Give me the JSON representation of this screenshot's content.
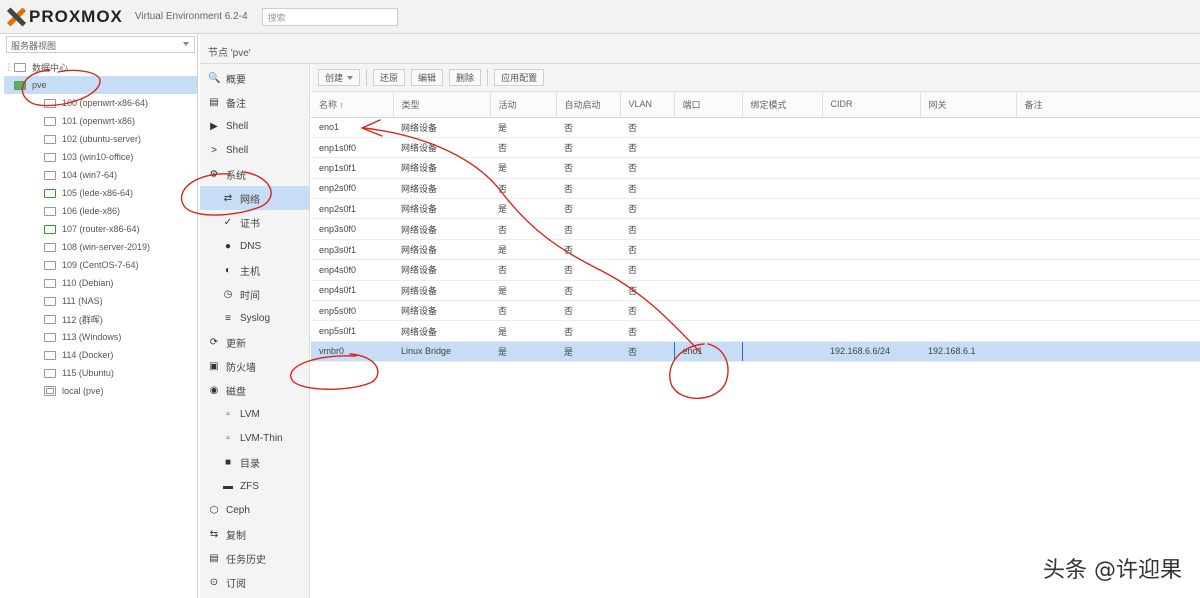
{
  "header": {
    "logo_text": "PROXMOX",
    "version_text": "Virtual Environment 6.2-4",
    "search_placeholder": "搜索"
  },
  "tree": {
    "view_selector": "服务器视图",
    "root": "数据中心",
    "node": "pve",
    "items": [
      {
        "label": "100 (openwrt-x86-64)",
        "state": "stopped"
      },
      {
        "label": "101 (openwrt-x86)",
        "state": "stopped"
      },
      {
        "label": "102 (ubuntu-server)",
        "state": "stopped"
      },
      {
        "label": "103 (win10-office)",
        "state": "stopped"
      },
      {
        "label": "104 (win7-64)",
        "state": "stopped"
      },
      {
        "label": "105 (lede-x86-64)",
        "state": "running"
      },
      {
        "label": "106 (lede-x86)",
        "state": "stopped"
      },
      {
        "label": "107 (router-x86-64)",
        "state": "running"
      },
      {
        "label": "108 (win-server-2019)",
        "state": "stopped"
      },
      {
        "label": "109 (CentOS-7-64)",
        "state": "stopped"
      },
      {
        "label": "110 (Debian)",
        "state": "stopped"
      },
      {
        "label": "111 (NAS)",
        "state": "stopped"
      },
      {
        "label": "112 (群晖)",
        "state": "stopped"
      },
      {
        "label": "113 (Windows)",
        "state": "stopped"
      },
      {
        "label": "114 (Docker)",
        "state": "stopped"
      },
      {
        "label": "115 (Ubuntu)",
        "state": "stopped"
      },
      {
        "label": "local (pve)",
        "state": "storage"
      }
    ]
  },
  "nav": {
    "title": "节点 'pve'",
    "items": [
      {
        "glyph": "🔍",
        "label": "概要",
        "sub": false,
        "active": false
      },
      {
        "glyph": "▤",
        "label": "备注",
        "sub": false,
        "active": false
      },
      {
        "glyph": "▶",
        "label": "Shell",
        "sub": false,
        "active": false
      },
      {
        "glyph": ">",
        "label": "Shell",
        "sub": false,
        "active": false
      },
      {
        "glyph": "⚙",
        "label": "系统",
        "sub": false,
        "active": false
      },
      {
        "glyph": "⇄",
        "label": "网络",
        "sub": true,
        "active": true
      },
      {
        "glyph": "✓",
        "label": "证书",
        "sub": true,
        "active": false
      },
      {
        "glyph": "●",
        "label": "DNS",
        "sub": true,
        "active": false
      },
      {
        "glyph": "◐",
        "label": "主机",
        "sub": true,
        "active": false
      },
      {
        "glyph": "◷",
        "label": "时间",
        "sub": true,
        "active": false
      },
      {
        "glyph": "≡",
        "label": "Syslog",
        "sub": true,
        "active": false
      },
      {
        "glyph": "⟳",
        "label": "更新",
        "sub": false,
        "active": false
      },
      {
        "glyph": "▣",
        "label": "防火墙",
        "sub": false,
        "active": false
      },
      {
        "glyph": "◉",
        "label": "磁盘",
        "sub": false,
        "active": false
      },
      {
        "glyph": "▫",
        "label": "LVM",
        "sub": true,
        "active": false
      },
      {
        "glyph": "▫",
        "label": "LVM-Thin",
        "sub": true,
        "active": false
      },
      {
        "glyph": "■",
        "label": "目录",
        "sub": true,
        "active": false
      },
      {
        "glyph": "▬",
        "label": "ZFS",
        "sub": true,
        "active": false
      },
      {
        "glyph": "⬡",
        "label": "Ceph",
        "sub": false,
        "active": false
      },
      {
        "glyph": "⇆",
        "label": "复制",
        "sub": false,
        "active": false
      },
      {
        "glyph": "▤",
        "label": "任务历史",
        "sub": false,
        "active": false
      },
      {
        "glyph": "⊙",
        "label": "订阅",
        "sub": false,
        "active": false
      }
    ]
  },
  "toolbar": {
    "create": "创建",
    "revert": "还原",
    "edit": "编辑",
    "delete": "删除",
    "apply": "应用配置"
  },
  "grid": {
    "columns": [
      "名称 ↑",
      "类型",
      "活动",
      "自动启动",
      "VLAN",
      "端口",
      "绑定模式",
      "CIDR",
      "网关",
      "备注"
    ],
    "rows": [
      {
        "name": "eno1",
        "type": "网络设备",
        "active": "是",
        "autostart": "否",
        "vlan": "否",
        "ports": "",
        "bond": "",
        "cidr": "",
        "gateway": "",
        "selected": false
      },
      {
        "name": "enp1s0f0",
        "type": "网络设备",
        "active": "否",
        "autostart": "否",
        "vlan": "否",
        "ports": "",
        "bond": "",
        "cidr": "",
        "gateway": "",
        "selected": false
      },
      {
        "name": "enp1s0f1",
        "type": "网络设备",
        "active": "是",
        "autostart": "否",
        "vlan": "否",
        "ports": "",
        "bond": "",
        "cidr": "",
        "gateway": "",
        "selected": false
      },
      {
        "name": "enp2s0f0",
        "type": "网络设备",
        "active": "否",
        "autostart": "否",
        "vlan": "否",
        "ports": "",
        "bond": "",
        "cidr": "",
        "gateway": "",
        "selected": false
      },
      {
        "name": "enp2s0f1",
        "type": "网络设备",
        "active": "是",
        "autostart": "否",
        "vlan": "否",
        "ports": "",
        "bond": "",
        "cidr": "",
        "gateway": "",
        "selected": false
      },
      {
        "name": "enp3s0f0",
        "type": "网络设备",
        "active": "否",
        "autostart": "否",
        "vlan": "否",
        "ports": "",
        "bond": "",
        "cidr": "",
        "gateway": "",
        "selected": false
      },
      {
        "name": "enp3s0f1",
        "type": "网络设备",
        "active": "是",
        "autostart": "否",
        "vlan": "否",
        "ports": "",
        "bond": "",
        "cidr": "",
        "gateway": "",
        "selected": false
      },
      {
        "name": "enp4s0f0",
        "type": "网络设备",
        "active": "否",
        "autostart": "否",
        "vlan": "否",
        "ports": "",
        "bond": "",
        "cidr": "",
        "gateway": "",
        "selected": false
      },
      {
        "name": "enp4s0f1",
        "type": "网络设备",
        "active": "是",
        "autostart": "否",
        "vlan": "否",
        "ports": "",
        "bond": "",
        "cidr": "",
        "gateway": "",
        "selected": false
      },
      {
        "name": "enp5s0f0",
        "type": "网络设备",
        "active": "否",
        "autostart": "否",
        "vlan": "否",
        "ports": "",
        "bond": "",
        "cidr": "",
        "gateway": "",
        "selected": false
      },
      {
        "name": "enp5s0f1",
        "type": "网络设备",
        "active": "是",
        "autostart": "否",
        "vlan": "否",
        "ports": "",
        "bond": "",
        "cidr": "",
        "gateway": "",
        "selected": false
      },
      {
        "name": "vmbr0",
        "type": "Linux Bridge",
        "active": "是",
        "autostart": "是",
        "vlan": "否",
        "ports": "eno1",
        "bond": "",
        "cidr": "192.168.6.6/24",
        "gateway": "192.168.6.1",
        "selected": true
      }
    ]
  },
  "watermark": "头条 @许迎果",
  "colors": {
    "annotation": "#d8261c",
    "selection": "#c6ddf5",
    "accent": "#e57000"
  }
}
